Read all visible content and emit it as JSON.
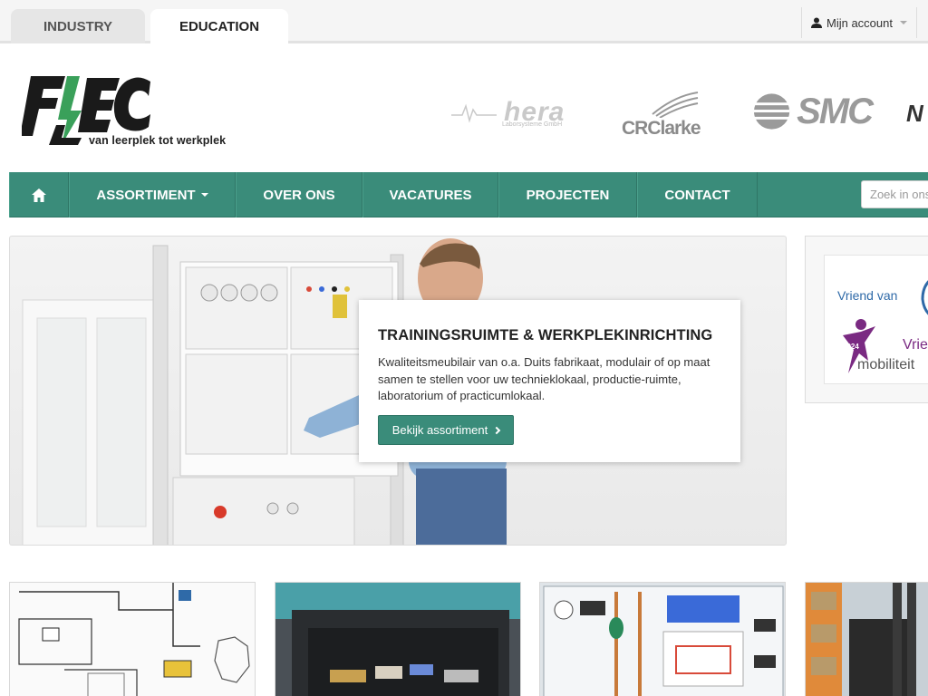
{
  "topbar": {
    "tabs": [
      {
        "label": "INDUSTRY",
        "active": false
      },
      {
        "label": "EDUCATION",
        "active": true
      }
    ],
    "account_label": "Mijn account"
  },
  "header": {
    "logo_text": "FLEC",
    "tagline": "van leerplek tot werkplek",
    "brands": {
      "hera": "hera",
      "hera_sub": "Laborsysteme GmbH",
      "crclarke": "CRClarke",
      "smc": "SMC",
      "partial": "N"
    }
  },
  "nav": {
    "home_icon": "home-icon",
    "items": [
      "ASSORTIMENT",
      "OVER ONS",
      "VACATURES",
      "PROJECTEN",
      "CONTACT"
    ],
    "search_placeholder": "Zoek in ons"
  },
  "hero": {
    "title": "TRAININGSRUIMTE & WERKPLEKINRICHTING",
    "text": "Kwaliteitsmeubilair van o.a. Duits fabrikaat, modulair of op maat samen te stellen voor uw technieklokaal, productie-ruimte, laboratorium of practicumlokaal.",
    "button_label": "Bekijk assortiment"
  },
  "side": {
    "vriend_1": "Vriend van",
    "vriend_2": "Vrie",
    "year": "2024",
    "mobiliteit": "mobiliteit"
  },
  "colors": {
    "accent": "#3a8c7a",
    "nav_border": "#2d7464"
  }
}
